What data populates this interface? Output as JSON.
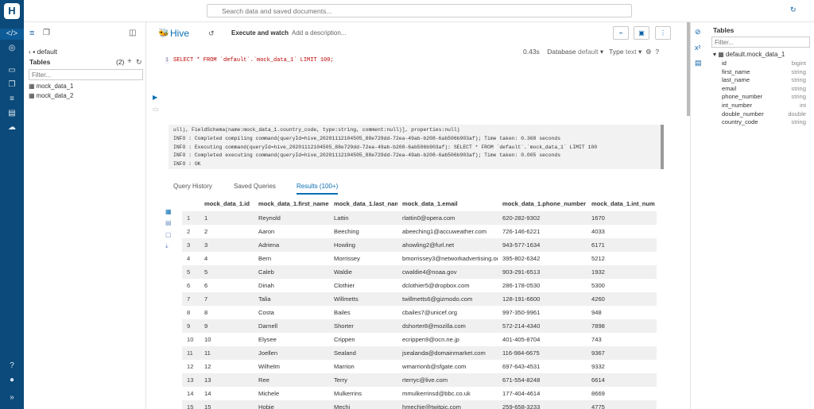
{
  "search": {
    "placeholder": "Search data and saved documents..."
  },
  "assist": {
    "database": "default",
    "tables_label": "Tables",
    "tables_count": "(2)",
    "filter_placeholder": "Filter...",
    "tables": [
      "mock_data_1",
      "mock_data_2"
    ]
  },
  "editor": {
    "title": "Hive",
    "execute_label": "Execute and watch",
    "description_placeholder": "Add a description...",
    "elapsed": "0.43s",
    "database_label": "Database",
    "database_value": "default",
    "type_label": "Type",
    "type_value": "text",
    "help": "?",
    "line_number": "1",
    "query": "SELECT * FROM `default`.`mock_data_1` LIMIT 100;"
  },
  "log": {
    "lines": [
      "ull), FieldSchema(name:mock_data_1.country_code, type:string, comment:null)], properties:null)",
      "INFO  : Completed compiling command(queryId=hive_20201112104505_88e729dd-72ea-49ab-b208-6ab506b903af); Time taken: 0.368 seconds",
      "INFO  : Executing command(queryId=hive_20201112104505_88e729dd-72ea-49ab-b208-6ab506b903af): SELECT * FROM `default`.`mock_data_1` LIMIT 100",
      "INFO  : Completed executing command(queryId=hive_20201112104505_88e729dd-72ea-49ab-b208-6ab506b903af); Time taken: 0.005 seconds",
      "INFO  : OK"
    ]
  },
  "results_tabs": [
    "Query History",
    "Saved Queries",
    "Results (100+)"
  ],
  "results": {
    "columns": [
      "",
      "mock_data_1.id",
      "mock_data_1.first_name",
      "mock_data_1.last_name",
      "mock_data_1.email",
      "mock_data_1.phone_number",
      "mock_data_1.int_num"
    ],
    "rows": [
      [
        "1",
        "1",
        "Reynold",
        "Lattin",
        "rlattin0@opera.com",
        "620-282-9302",
        "1670"
      ],
      [
        "2",
        "2",
        "Aaron",
        "Beeching",
        "abeeching1@accuweather.com",
        "726-146-6221",
        "4033"
      ],
      [
        "3",
        "3",
        "Adriena",
        "Howling",
        "ahowling2@furl.net",
        "943-577-1634",
        "6171"
      ],
      [
        "4",
        "4",
        "Bern",
        "Morrissey",
        "bmorrissey3@networkadvertising.org",
        "395-802-6342",
        "5212"
      ],
      [
        "5",
        "5",
        "Caleb",
        "Waldie",
        "cwaldie4@noaa.gov",
        "903-291-6513",
        "1932"
      ],
      [
        "6",
        "6",
        "Dinah",
        "Clothier",
        "dclothier5@dropbox.com",
        "286-178-0530",
        "5300"
      ],
      [
        "7",
        "7",
        "Talia",
        "Willmetts",
        "twillmetts6@gizmodo.com",
        "128-191-6600",
        "4260"
      ],
      [
        "8",
        "8",
        "Costa",
        "Bailes",
        "cbailes7@unicef.org",
        "997-350-9961",
        "948"
      ],
      [
        "9",
        "9",
        "Darnell",
        "Shorter",
        "dshorter8@mozilla.com",
        "572-214-4340",
        "7898"
      ],
      [
        "10",
        "10",
        "Elysee",
        "Crippen",
        "ecrippen9@ocn.ne.jp",
        "401-405-8704",
        "743"
      ],
      [
        "11",
        "11",
        "Joellen",
        "Sealand",
        "jsealanda@domainmarket.com",
        "116-984-6675",
        "9367"
      ],
      [
        "12",
        "12",
        "Wilhelm",
        "Marrion",
        "wmarrionb@sfgate.com",
        "697-643-4531",
        "9332"
      ],
      [
        "13",
        "13",
        "Ree",
        "Terry",
        "rterryc@live.com",
        "671-554-8248",
        "6614"
      ],
      [
        "14",
        "14",
        "Michele",
        "Mulkerrins",
        "mmulkerrinsd@bbc.co.uk",
        "177-404-4614",
        "8669"
      ],
      [
        "15",
        "15",
        "Hobie",
        "Mechi",
        "hmechie@twitpic.com",
        "259-658-3233",
        "4775"
      ]
    ]
  },
  "right_panel": {
    "title": "Tables",
    "filter_placeholder": "Filter...",
    "table": "default.mock_data_1",
    "columns": [
      {
        "name": "id",
        "type": "bigint"
      },
      {
        "name": "first_name",
        "type": "string"
      },
      {
        "name": "last_name",
        "type": "string"
      },
      {
        "name": "email",
        "type": "string"
      },
      {
        "name": "phone_number",
        "type": "string"
      },
      {
        "name": "int_number",
        "type": "int"
      },
      {
        "name": "double_number",
        "type": "double"
      },
      {
        "name": "country_code",
        "type": "string"
      }
    ]
  }
}
